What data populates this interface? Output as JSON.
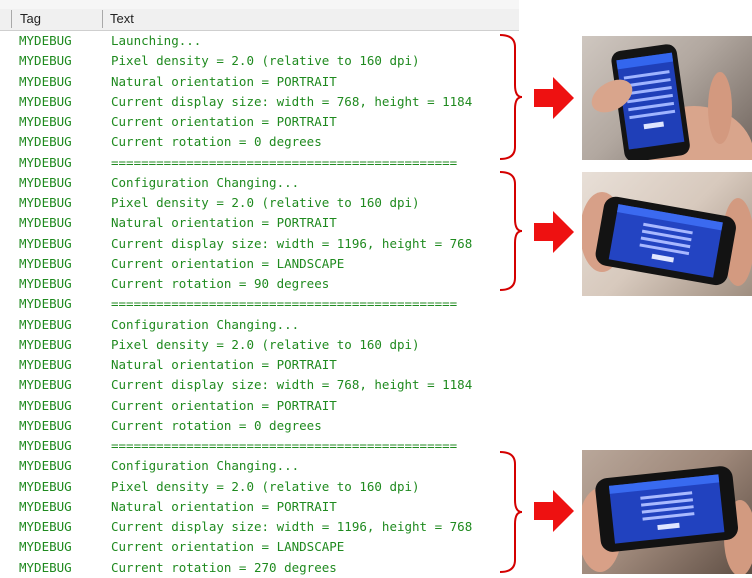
{
  "header": {
    "tag_label": "Tag",
    "text_label": "Text"
  },
  "log_rows": [
    {
      "tag": "MYDEBUG",
      "text": "Launching..."
    },
    {
      "tag": "MYDEBUG",
      "text": "Pixel density = 2.0 (relative to 160 dpi)"
    },
    {
      "tag": "MYDEBUG",
      "text": "Natural orientation = PORTRAIT"
    },
    {
      "tag": "MYDEBUG",
      "text": "Current display size: width = 768, height = 1184"
    },
    {
      "tag": "MYDEBUG",
      "text": "Current orientation = PORTRAIT"
    },
    {
      "tag": "MYDEBUG",
      "text": "Current rotation = 0 degrees"
    },
    {
      "tag": "MYDEBUG",
      "text": "=============================================="
    },
    {
      "tag": "MYDEBUG",
      "text": "Configuration Changing..."
    },
    {
      "tag": "MYDEBUG",
      "text": "Pixel density = 2.0 (relative to 160 dpi)"
    },
    {
      "tag": "MYDEBUG",
      "text": "Natural orientation = PORTRAIT"
    },
    {
      "tag": "MYDEBUG",
      "text": "Current display size: width = 1196, height = 768"
    },
    {
      "tag": "MYDEBUG",
      "text": "Current orientation = LANDSCAPE"
    },
    {
      "tag": "MYDEBUG",
      "text": "Current rotation = 90 degrees"
    },
    {
      "tag": "MYDEBUG",
      "text": "=============================================="
    },
    {
      "tag": "MYDEBUG",
      "text": "Configuration Changing..."
    },
    {
      "tag": "MYDEBUG",
      "text": "Pixel density = 2.0 (relative to 160 dpi)"
    },
    {
      "tag": "MYDEBUG",
      "text": "Natural orientation = PORTRAIT"
    },
    {
      "tag": "MYDEBUG",
      "text": "Current display size: width = 768, height = 1184"
    },
    {
      "tag": "MYDEBUG",
      "text": "Current orientation = PORTRAIT"
    },
    {
      "tag": "MYDEBUG",
      "text": "Current rotation = 0 degrees"
    },
    {
      "tag": "MYDEBUG",
      "text": "=============================================="
    },
    {
      "tag": "MYDEBUG",
      "text": "Configuration Changing..."
    },
    {
      "tag": "MYDEBUG",
      "text": "Pixel density = 2.0 (relative to 160 dpi)"
    },
    {
      "tag": "MYDEBUG",
      "text": "Natural orientation = PORTRAIT"
    },
    {
      "tag": "MYDEBUG",
      "text": "Current display size: width = 1196, height = 768"
    },
    {
      "tag": "MYDEBUG",
      "text": "Current orientation = LANDSCAPE"
    },
    {
      "tag": "MYDEBUG",
      "text": "Current rotation = 270 degrees"
    }
  ],
  "colors": {
    "log_text": "#1f8a1f",
    "brace": "#d40000",
    "arrow": "#ee1111"
  },
  "annotations": [
    {
      "name": "annotation-portrait",
      "photo": "phone-portrait-photo",
      "orientation": "portrait"
    },
    {
      "name": "annotation-landscape-90",
      "photo": "phone-landscape-90-photo",
      "orientation": "landscape"
    },
    {
      "name": "annotation-landscape-270",
      "photo": "phone-landscape-270-photo",
      "orientation": "landscape"
    }
  ]
}
